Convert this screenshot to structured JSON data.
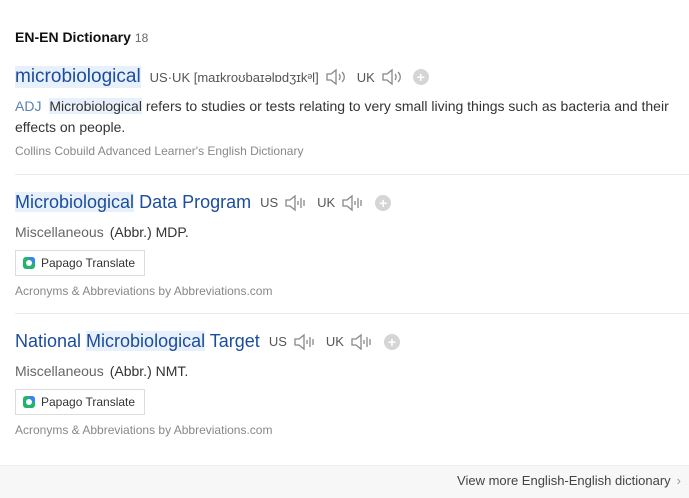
{
  "header": {
    "title": "EN-EN Dictionary",
    "count": "18"
  },
  "entries": [
    {
      "headword": "microbiological",
      "pron": [
        {
          "label": "US·UK [maɪkroʊbaɪəlɒdʒɪkᵊl]",
          "icon": "speaker-icon"
        },
        {
          "label": "UK",
          "icon": "speaker-icon"
        }
      ],
      "pos": "ADJ",
      "def_highlight": "Microbiological",
      "def_rest": " refers to studies or tests relating to very small living things such as bacteria and their effects on people.",
      "source": "Collins Cobuild Advanced Learner's English Dictionary"
    },
    {
      "headword_hl": "Microbiological",
      "headword_rest": " Data Program",
      "pron": [
        {
          "label": "US"
        },
        {
          "label": "UK"
        }
      ],
      "category": "Miscellaneous",
      "abbr": "(Abbr.) MDP.",
      "translate_label": "Papago Translate",
      "source": "Acronyms & Abbreviations by Abbreviations.com"
    },
    {
      "headword_pre": "National ",
      "headword_hl": "Microbiological",
      "headword_rest": " Target",
      "pron": [
        {
          "label": "US"
        },
        {
          "label": "UK"
        }
      ],
      "category": "Miscellaneous",
      "abbr": "(Abbr.) NMT.",
      "translate_label": "Papago Translate",
      "source": "Acronyms & Abbreviations by Abbreviations.com"
    }
  ],
  "footer": {
    "more_label": "View more English-English dictionary",
    "chevron": "›"
  }
}
